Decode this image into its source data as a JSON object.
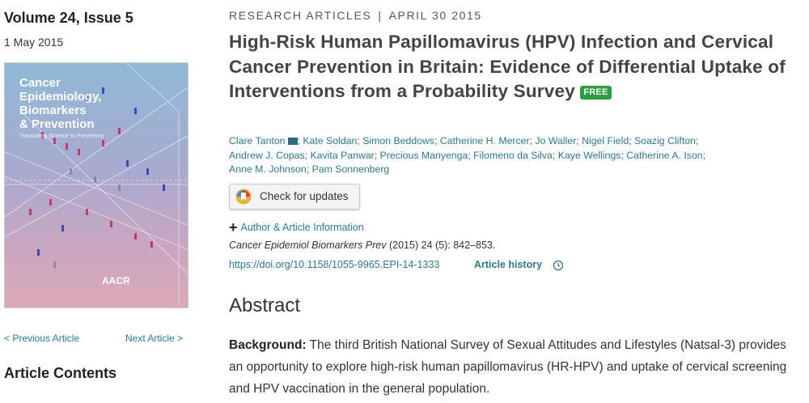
{
  "issue": {
    "title": "Volume 24, Issue 5",
    "date": "1 May 2015",
    "cover": {
      "title_line1": "Cancer",
      "title_line2": "Epidemiology,",
      "title_line3": "Biomarkers",
      "title_line4": "& Prevention",
      "subtitle": "Translating Science to Prevention",
      "logo": "AACR"
    }
  },
  "nav": {
    "prev": "< Previous Article",
    "next": "Next Article >",
    "contents": "Article Contents"
  },
  "article": {
    "kicker_type": "RESEARCH ARTICLES",
    "kicker_sep": "|",
    "kicker_date": "APRIL 30 2015",
    "title": "High-Risk Human Papillomavirus (HPV) Infection and Cervical Cancer Prevention in Britain: Evidence of Differential Uptake of Interventions from a Probability Survey",
    "free_badge": "FREE",
    "authors": [
      "Clare Tanton",
      "Kate Soldan",
      "Simon Beddows",
      "Catherine H. Mercer",
      "Jo Waller",
      "Nigel Field",
      "Soazig Clifton",
      "Andrew J. Copas",
      "Kavita Panwar",
      "Precious Manyenga",
      "Filomeno da Silva",
      "Kaye Wellings",
      "Catherine A. Ison",
      "Anne M. Johnson",
      "Pam Sonnenberg"
    ],
    "check_updates": "Check for updates",
    "author_info": "Author & Article Information",
    "citation_journal": "Cancer Epidemiol Biomarkers Prev",
    "citation_rest": " (2015) 24 (5): 842–853.",
    "doi": "https://doi.org/10.1158/1055-9965.EPI-14-1333",
    "history": "Article history",
    "abstract_heading": "Abstract",
    "abstract_label": "Background:",
    "abstract_text": " The third British National Survey of Sexual Attitudes and Lifestyles (Natsal-3) provides an opportunity to explore high-risk human papillomavirus (HR-HPV) and uptake of cervical screening and HPV vaccination in the general population."
  }
}
